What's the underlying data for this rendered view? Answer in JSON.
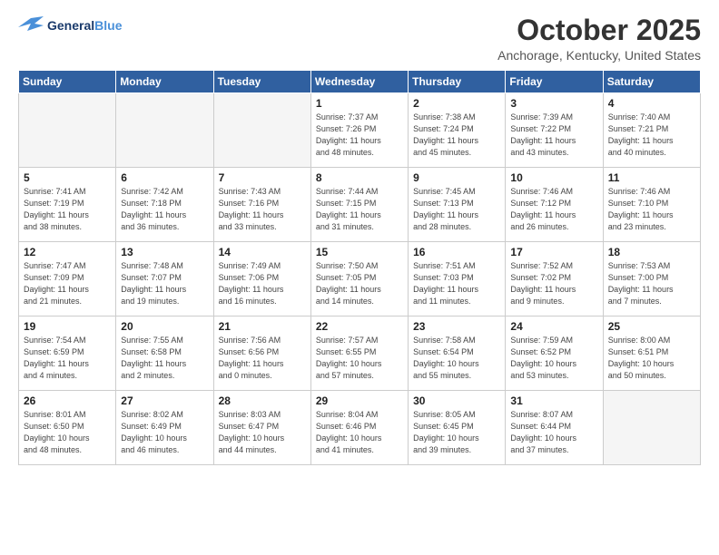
{
  "header": {
    "logo_line1": "General",
    "logo_line2": "Blue",
    "month": "October 2025",
    "location": "Anchorage, Kentucky, United States"
  },
  "weekdays": [
    "Sunday",
    "Monday",
    "Tuesday",
    "Wednesday",
    "Thursday",
    "Friday",
    "Saturday"
  ],
  "weeks": [
    [
      {
        "day": "",
        "info": ""
      },
      {
        "day": "",
        "info": ""
      },
      {
        "day": "",
        "info": ""
      },
      {
        "day": "1",
        "info": "Sunrise: 7:37 AM\nSunset: 7:26 PM\nDaylight: 11 hours\nand 48 minutes."
      },
      {
        "day": "2",
        "info": "Sunrise: 7:38 AM\nSunset: 7:24 PM\nDaylight: 11 hours\nand 45 minutes."
      },
      {
        "day": "3",
        "info": "Sunrise: 7:39 AM\nSunset: 7:22 PM\nDaylight: 11 hours\nand 43 minutes."
      },
      {
        "day": "4",
        "info": "Sunrise: 7:40 AM\nSunset: 7:21 PM\nDaylight: 11 hours\nand 40 minutes."
      }
    ],
    [
      {
        "day": "5",
        "info": "Sunrise: 7:41 AM\nSunset: 7:19 PM\nDaylight: 11 hours\nand 38 minutes."
      },
      {
        "day": "6",
        "info": "Sunrise: 7:42 AM\nSunset: 7:18 PM\nDaylight: 11 hours\nand 36 minutes."
      },
      {
        "day": "7",
        "info": "Sunrise: 7:43 AM\nSunset: 7:16 PM\nDaylight: 11 hours\nand 33 minutes."
      },
      {
        "day": "8",
        "info": "Sunrise: 7:44 AM\nSunset: 7:15 PM\nDaylight: 11 hours\nand 31 minutes."
      },
      {
        "day": "9",
        "info": "Sunrise: 7:45 AM\nSunset: 7:13 PM\nDaylight: 11 hours\nand 28 minutes."
      },
      {
        "day": "10",
        "info": "Sunrise: 7:46 AM\nSunset: 7:12 PM\nDaylight: 11 hours\nand 26 minutes."
      },
      {
        "day": "11",
        "info": "Sunrise: 7:46 AM\nSunset: 7:10 PM\nDaylight: 11 hours\nand 23 minutes."
      }
    ],
    [
      {
        "day": "12",
        "info": "Sunrise: 7:47 AM\nSunset: 7:09 PM\nDaylight: 11 hours\nand 21 minutes."
      },
      {
        "day": "13",
        "info": "Sunrise: 7:48 AM\nSunset: 7:07 PM\nDaylight: 11 hours\nand 19 minutes."
      },
      {
        "day": "14",
        "info": "Sunrise: 7:49 AM\nSunset: 7:06 PM\nDaylight: 11 hours\nand 16 minutes."
      },
      {
        "day": "15",
        "info": "Sunrise: 7:50 AM\nSunset: 7:05 PM\nDaylight: 11 hours\nand 14 minutes."
      },
      {
        "day": "16",
        "info": "Sunrise: 7:51 AM\nSunset: 7:03 PM\nDaylight: 11 hours\nand 11 minutes."
      },
      {
        "day": "17",
        "info": "Sunrise: 7:52 AM\nSunset: 7:02 PM\nDaylight: 11 hours\nand 9 minutes."
      },
      {
        "day": "18",
        "info": "Sunrise: 7:53 AM\nSunset: 7:00 PM\nDaylight: 11 hours\nand 7 minutes."
      }
    ],
    [
      {
        "day": "19",
        "info": "Sunrise: 7:54 AM\nSunset: 6:59 PM\nDaylight: 11 hours\nand 4 minutes."
      },
      {
        "day": "20",
        "info": "Sunrise: 7:55 AM\nSunset: 6:58 PM\nDaylight: 11 hours\nand 2 minutes."
      },
      {
        "day": "21",
        "info": "Sunrise: 7:56 AM\nSunset: 6:56 PM\nDaylight: 11 hours\nand 0 minutes."
      },
      {
        "day": "22",
        "info": "Sunrise: 7:57 AM\nSunset: 6:55 PM\nDaylight: 10 hours\nand 57 minutes."
      },
      {
        "day": "23",
        "info": "Sunrise: 7:58 AM\nSunset: 6:54 PM\nDaylight: 10 hours\nand 55 minutes."
      },
      {
        "day": "24",
        "info": "Sunrise: 7:59 AM\nSunset: 6:52 PM\nDaylight: 10 hours\nand 53 minutes."
      },
      {
        "day": "25",
        "info": "Sunrise: 8:00 AM\nSunset: 6:51 PM\nDaylight: 10 hours\nand 50 minutes."
      }
    ],
    [
      {
        "day": "26",
        "info": "Sunrise: 8:01 AM\nSunset: 6:50 PM\nDaylight: 10 hours\nand 48 minutes."
      },
      {
        "day": "27",
        "info": "Sunrise: 8:02 AM\nSunset: 6:49 PM\nDaylight: 10 hours\nand 46 minutes."
      },
      {
        "day": "28",
        "info": "Sunrise: 8:03 AM\nSunset: 6:47 PM\nDaylight: 10 hours\nand 44 minutes."
      },
      {
        "day": "29",
        "info": "Sunrise: 8:04 AM\nSunset: 6:46 PM\nDaylight: 10 hours\nand 41 minutes."
      },
      {
        "day": "30",
        "info": "Sunrise: 8:05 AM\nSunset: 6:45 PM\nDaylight: 10 hours\nand 39 minutes."
      },
      {
        "day": "31",
        "info": "Sunrise: 8:07 AM\nSunset: 6:44 PM\nDaylight: 10 hours\nand 37 minutes."
      },
      {
        "day": "",
        "info": ""
      }
    ]
  ]
}
